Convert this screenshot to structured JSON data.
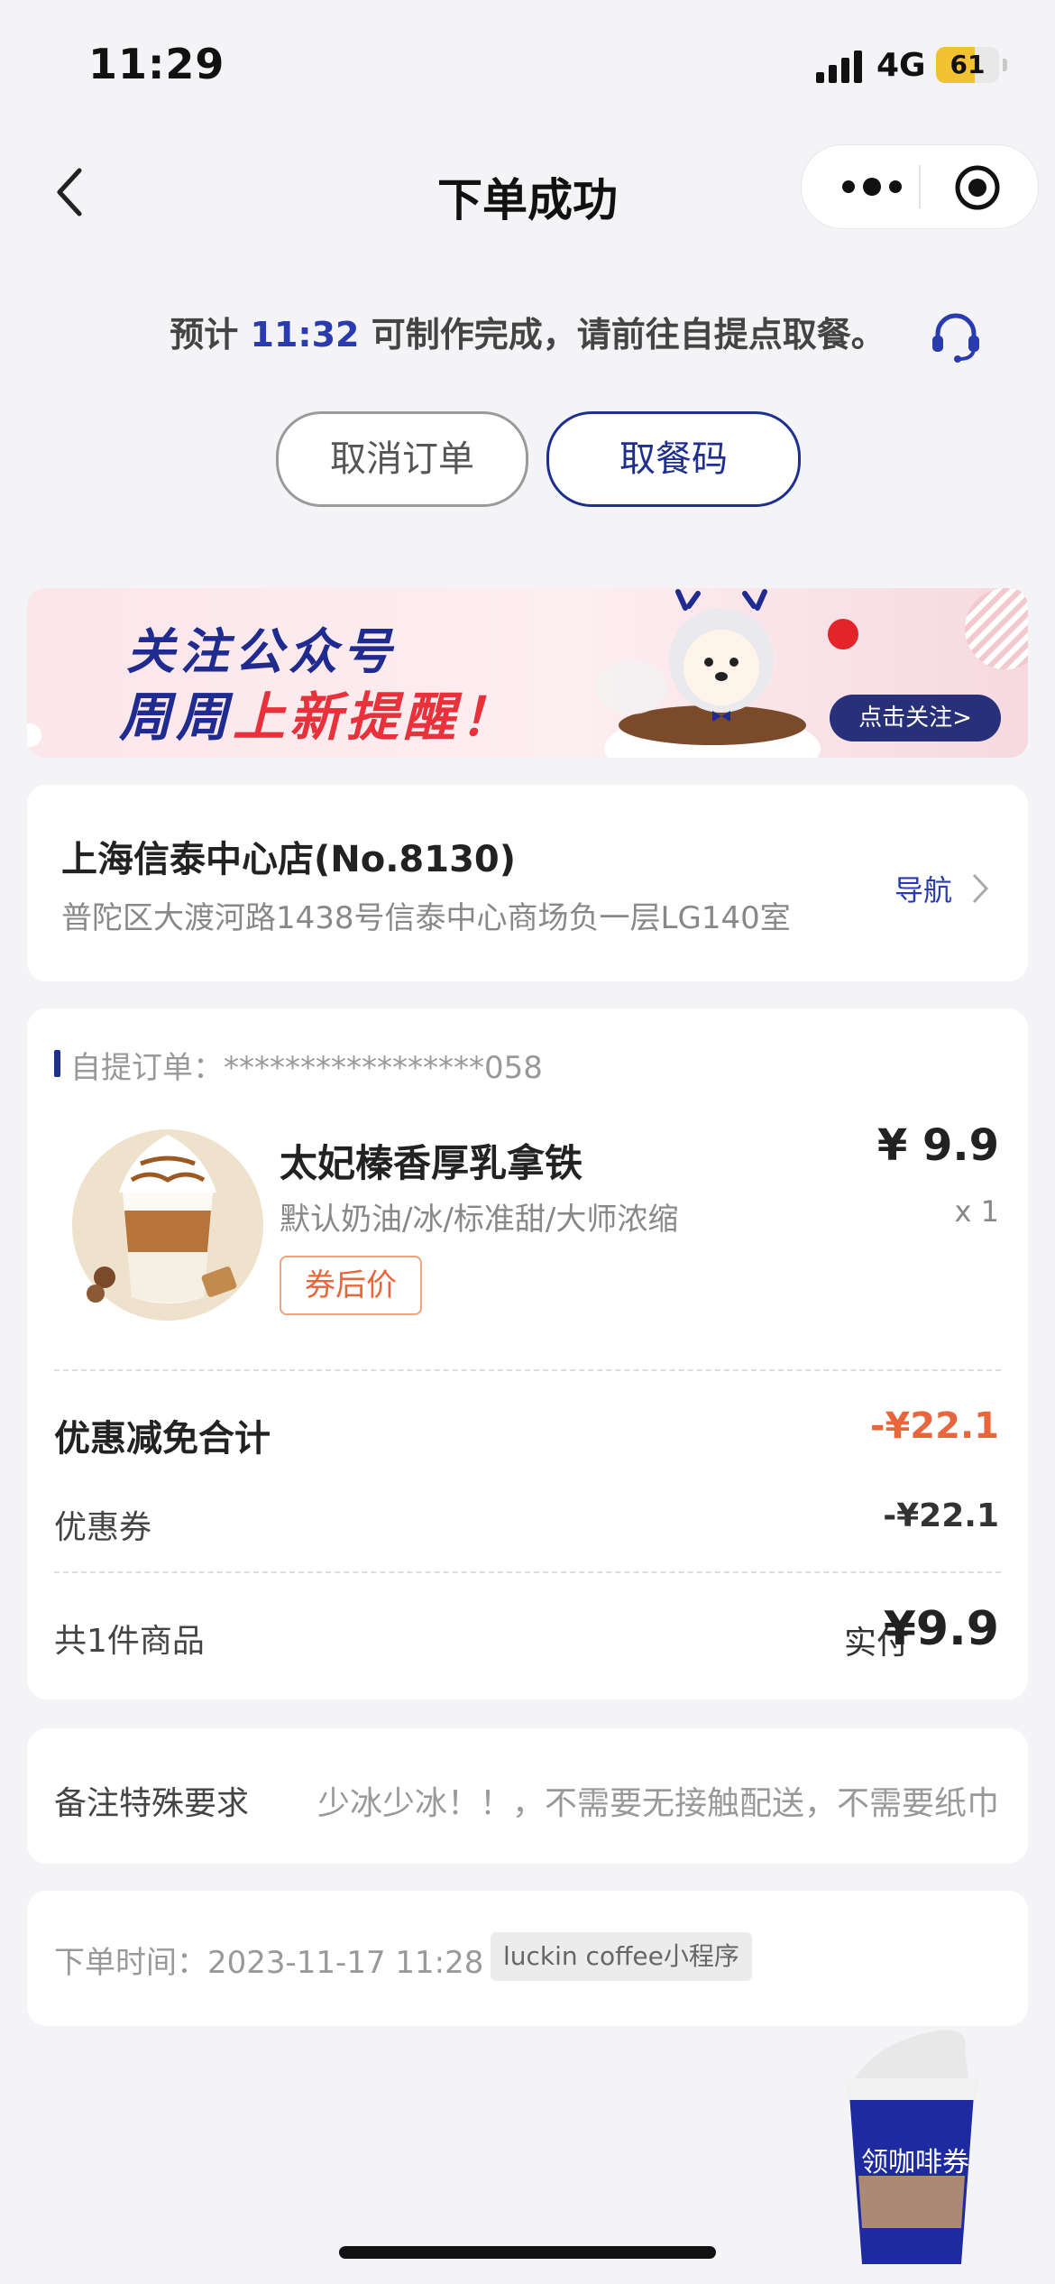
{
  "status_bar": {
    "time": "11:29",
    "network": "4G",
    "battery": "61",
    "battery_level": 0.61
  },
  "nav": {
    "title": "下单成功"
  },
  "notice": {
    "prefix": "预计 ",
    "time": "11:32",
    "suffix": " 可制作完成，请前往自提点取餐。"
  },
  "actions": {
    "cancel": "取消订单",
    "pickup_code": "取餐码"
  },
  "banner": {
    "line1": "关注公众号",
    "line2a": "周周",
    "line2b": "上新提醒！",
    "button": "点击关注>"
  },
  "store": {
    "name": "上海信泰中心店(No.8130)",
    "address": "普陀区大渡河路1438号信泰中心商场负一层LG140室",
    "nav_label": "导航"
  },
  "order": {
    "label": "自提订单：",
    "number": "*****************058",
    "product": {
      "name": "太妃榛香厚乳拿铁",
      "spec": "默认奶油/冰/标准甜/大师浓缩",
      "tag": "券后价",
      "price": "¥ 9.9",
      "qty": "x 1"
    },
    "discount_total_label": "优惠减免合计",
    "discount_total": "-¥22.1",
    "coupon_label": "优惠券",
    "coupon_value": "-¥22.1",
    "item_count": "共1件商品",
    "paid_label": "实付",
    "paid_value": "¥9.9"
  },
  "remark": {
    "label": "备注特殊要求",
    "value": "少冰少冰！！，不需要无接触配送，不需要纸巾"
  },
  "order_time": {
    "label": "下单时间：2023-11-17 11:28",
    "source": "luckin coffee小程序"
  },
  "floating": {
    "label": "领咖啡券"
  },
  "colors": {
    "brand": "#1e2f8f",
    "accent": "#e8663c",
    "background": "#f4f4f6"
  }
}
